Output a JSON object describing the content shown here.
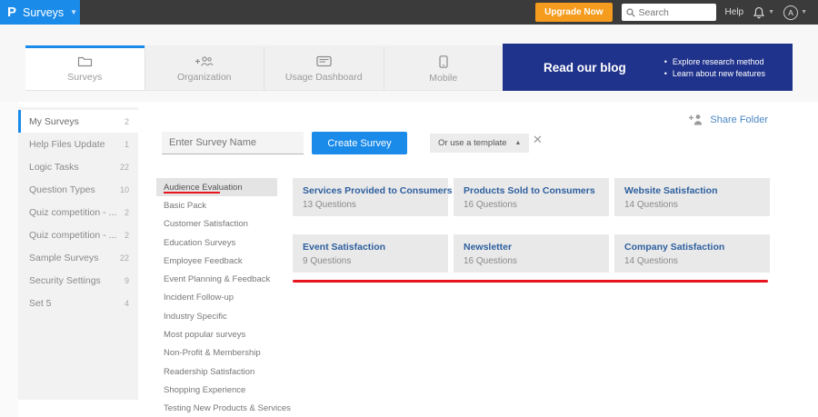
{
  "topbar": {
    "logo_letter": "P",
    "product_label": "Surveys",
    "upgrade_label": "Upgrade Now",
    "search_placeholder": "Search",
    "help_label": "Help",
    "avatar_initial": "A"
  },
  "header": {
    "tabs": [
      {
        "label": "Surveys"
      },
      {
        "label": "Organization"
      },
      {
        "label": "Usage Dashboard"
      },
      {
        "label": "Mobile"
      }
    ],
    "banner": {
      "title": "Read our blog",
      "bullets": [
        "Explore research method",
        "Learn about new features"
      ]
    }
  },
  "sidebar": {
    "items": [
      {
        "label": "My Surveys",
        "count": "2"
      },
      {
        "label": "Help Files Update",
        "count": "1"
      },
      {
        "label": "Logic Tasks",
        "count": "22"
      },
      {
        "label": "Question Types",
        "count": "10"
      },
      {
        "label": "Quiz competition - ...",
        "count": "2"
      },
      {
        "label": "Quiz competition - ...",
        "count": "2"
      },
      {
        "label": "Sample Surveys",
        "count": "22"
      },
      {
        "label": "Security Settings",
        "count": "9"
      },
      {
        "label": "Set 5",
        "count": "4"
      }
    ]
  },
  "main": {
    "share_folder_label": "Share Folder",
    "survey_name_placeholder": "Enter Survey Name",
    "create_button_label": "Create Survey",
    "template_dropdown_label": "Or use a template",
    "close_icon_glyph": "✕",
    "categories": [
      "Audience Evaluation",
      "Basic Pack",
      "Customer Satisfaction",
      "Education Surveys",
      "Employee Feedback",
      "Event Planning & Feedback",
      "Incident Follow-up",
      "Industry Specific",
      "Most popular surveys",
      "Non-Profit & Membership",
      "Readership Satisfaction",
      "Shopping Experience",
      "Testing New Products & Services"
    ],
    "templates": [
      {
        "title": "Services Provided to Consumers",
        "questions": "13 Questions"
      },
      {
        "title": "Products Sold to Consumers",
        "questions": "16 Questions"
      },
      {
        "title": "Website Satisfaction",
        "questions": "14 Questions"
      },
      {
        "title": "Event Satisfaction",
        "questions": "9 Questions"
      },
      {
        "title": "Newsletter",
        "questions": "16 Questions"
      },
      {
        "title": "Company Satisfaction",
        "questions": "14 Questions"
      }
    ]
  },
  "colors": {
    "brand_blue": "#1b8bea",
    "topbar_dark": "#3b3b3b",
    "upgrade_orange": "#f59b1e",
    "banner_navy": "#20338c",
    "card_title_blue": "#2d5f9e",
    "annotation_red": "#e8141e"
  }
}
